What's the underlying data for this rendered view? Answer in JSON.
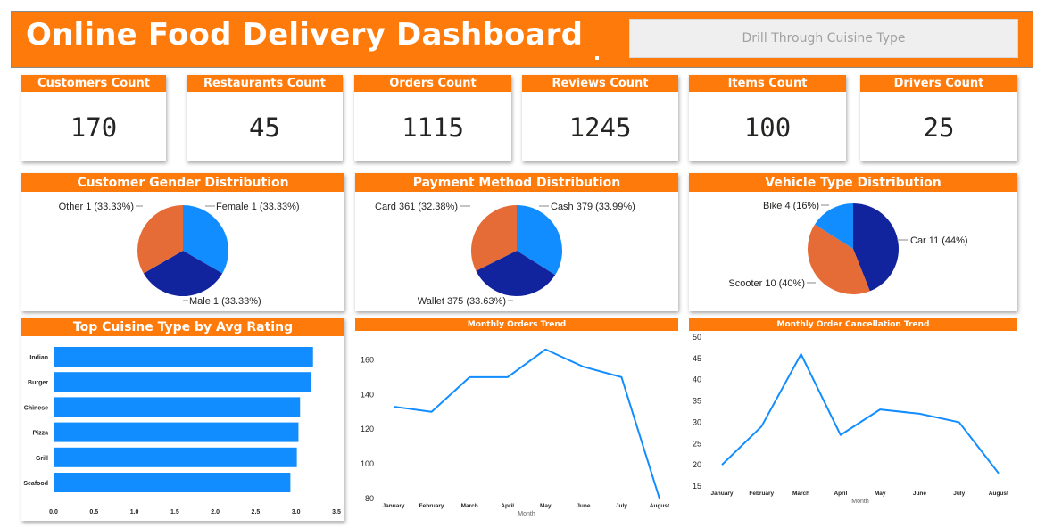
{
  "header": {
    "title": "Online Food Delivery Dashboard",
    "drill_label": "Drill Through Cuisine Type"
  },
  "colors": {
    "accent": "#fd7a0b",
    "blue": "#118dff",
    "navy": "#12239e",
    "orange_slice": "#e66c37"
  },
  "kpis": [
    {
      "label": "Customers Count",
      "value": "170"
    },
    {
      "label": "Restaurants Count",
      "value": "45"
    },
    {
      "label": "Orders Count",
      "value": "1115"
    },
    {
      "label": "Reviews Count",
      "value": "1245"
    },
    {
      "label": "Items Count",
      "value": "100"
    },
    {
      "label": "Drivers Count",
      "value": "25"
    }
  ],
  "chart_data": [
    {
      "type": "pie",
      "title": "Customer Gender Distribution",
      "slices": [
        {
          "name": "Female",
          "value": 1,
          "label": "Female 1 (33.33%)",
          "color": "#118dff"
        },
        {
          "name": "Male",
          "value": 1,
          "label": "Male 1 (33.33%)",
          "color": "#12239e"
        },
        {
          "name": "Other",
          "value": 1,
          "label": "Other 1 (33.33%)",
          "color": "#e66c37"
        }
      ]
    },
    {
      "type": "pie",
      "title": "Payment Method Distribution",
      "slices": [
        {
          "name": "Cash",
          "value": 379,
          "label": "Cash 379 (33.99%)",
          "color": "#118dff"
        },
        {
          "name": "Wallet",
          "value": 375,
          "label": "Wallet 375 (33.63%)",
          "color": "#12239e"
        },
        {
          "name": "Card",
          "value": 361,
          "label": "Card 361 (32.38%)",
          "color": "#e66c37"
        }
      ]
    },
    {
      "type": "pie",
      "title": "Vehicle Type Distribution",
      "slices": [
        {
          "name": "Car",
          "value": 11,
          "label": "Car 11 (44%)",
          "color": "#12239e"
        },
        {
          "name": "Scooter",
          "value": 10,
          "label": "Scooter 10 (40%)",
          "color": "#e66c37"
        },
        {
          "name": "Bike",
          "value": 4,
          "label": "Bike 4 (16%)",
          "color": "#118dff"
        }
      ]
    },
    {
      "type": "bar",
      "orientation": "horizontal",
      "title": "Top Cuisine Type by Avg Rating",
      "categories": [
        "Indian",
        "Burger",
        "Chinese",
        "Pizza",
        "Grill",
        "Seafood"
      ],
      "values": [
        3.21,
        3.18,
        3.05,
        3.03,
        3.01,
        2.93
      ],
      "xlim": [
        0,
        3.5
      ],
      "ticks": [
        "0.0",
        "0.5",
        "1.0",
        "1.5",
        "2.0",
        "2.5",
        "3.0",
        "3.5"
      ],
      "color": "#118dff"
    },
    {
      "type": "line",
      "title": "Monthly Orders Trend",
      "xlabel": "Month",
      "categories": [
        "January",
        "February",
        "March",
        "April",
        "May",
        "June",
        "July",
        "August"
      ],
      "values": [
        133,
        130,
        150,
        150,
        166,
        156,
        150,
        80
      ],
      "ylim": [
        80,
        170
      ],
      "yticks": [
        "80",
        "100",
        "120",
        "140",
        "160"
      ],
      "color": "#118dff"
    },
    {
      "type": "line",
      "title": "Monthly Order Cancellation Trend",
      "xlabel": "Month",
      "categories": [
        "January",
        "February",
        "March",
        "April",
        "May",
        "June",
        "July",
        "August"
      ],
      "values": [
        20,
        29,
        46,
        27,
        33,
        32,
        30,
        18
      ],
      "ylim": [
        15,
        50
      ],
      "yticks": [
        "15",
        "20",
        "25",
        "30",
        "35",
        "40",
        "45",
        "50"
      ],
      "color": "#118dff"
    }
  ]
}
